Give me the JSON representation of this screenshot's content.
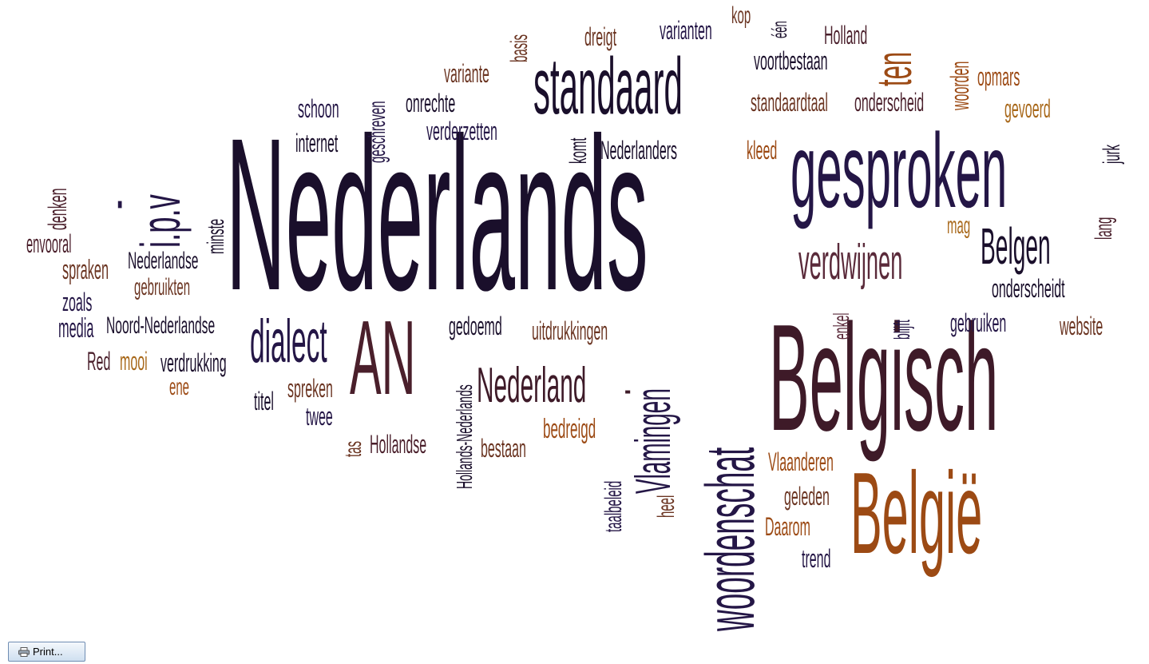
{
  "colors": {
    "dark": "#1a0f2b",
    "navy": "#241646",
    "maroon": "#4a1f2b",
    "brown": "#6b3522",
    "rust": "#9c4a14",
    "ochre": "#a8681a",
    "mauve": "#5a2a3a"
  },
  "words": [
    "Nederlands",
    "gesproken",
    "standaard",
    "Belgisch",
    "België",
    "woordenschat",
    "AN",
    "Vlamingen",
    "Nederland",
    "dialect",
    "i.p.v",
    "verdwijnen",
    "Belgen",
    "ten",
    "Hollands-Nederlands",
    "Noord-Nederlandse",
    "Nederlandse",
    "gebruikten",
    "spraken",
    "envooral",
    "denken",
    "minste",
    "zoals",
    "media",
    "Red",
    "mooi",
    "verdrukking",
    "ene",
    "titel",
    "spreken",
    "twee",
    "tas",
    "Hollandse",
    "bestaan",
    "bedreigd",
    "gedoemd",
    "uitdrukkingen",
    "taalbeleid",
    "heel",
    "Vlaanderen",
    "geleden",
    "Daarom",
    "trend",
    "enkel",
    "blijft",
    "gebruiken",
    "website",
    "onderscheidt",
    "lang",
    "mag",
    "kleed",
    "jurk",
    "gevoerd",
    "opmars",
    "woorden",
    "onderscheid",
    "standaardtaal",
    "voortbestaan",
    "Holland",
    "één",
    "kop",
    "varianten",
    "dreigt",
    "basis",
    "variante",
    "onrechte",
    "verderzetten",
    "schoon",
    "internet",
    "geschreven",
    "komt",
    "Nederlanders",
    "-",
    "-"
  ],
  "print_button": {
    "label": "Print..."
  }
}
